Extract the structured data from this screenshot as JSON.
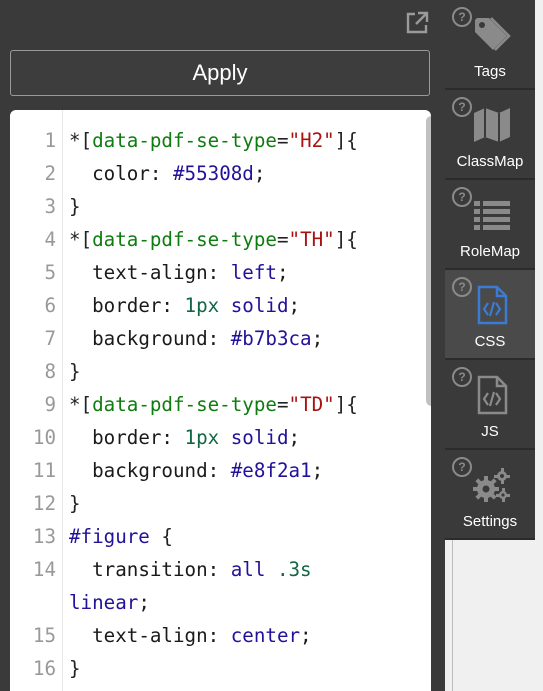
{
  "toolbar": {
    "apply_label": "Apply"
  },
  "editor": {
    "lines": [
      {
        "num": "1",
        "parts": [
          {
            "c": "t-sel",
            "t": "*["
          },
          {
            "c": "t-attr",
            "t": "data-pdf-se-type"
          },
          {
            "c": "t-sel",
            "t": "="
          },
          {
            "c": "t-str",
            "t": "\"H2\""
          },
          {
            "c": "t-sel",
            "t": "]{"
          }
        ]
      },
      {
        "num": "2",
        "parts": [
          {
            "c": "t-prop",
            "t": "  color: "
          },
          {
            "c": "t-val",
            "t": "#55308d"
          },
          {
            "c": "t-prop",
            "t": ";"
          }
        ]
      },
      {
        "num": "3",
        "parts": [
          {
            "c": "t-sel",
            "t": "}"
          }
        ]
      },
      {
        "num": "4",
        "parts": [
          {
            "c": "t-sel",
            "t": "*["
          },
          {
            "c": "t-attr",
            "t": "data-pdf-se-type"
          },
          {
            "c": "t-sel",
            "t": "="
          },
          {
            "c": "t-str",
            "t": "\"TH\""
          },
          {
            "c": "t-sel",
            "t": "]{"
          }
        ]
      },
      {
        "num": "5",
        "parts": [
          {
            "c": "t-prop",
            "t": "  text-align: "
          },
          {
            "c": "t-val",
            "t": "left"
          },
          {
            "c": "t-prop",
            "t": ";"
          }
        ]
      },
      {
        "num": "6",
        "parts": [
          {
            "c": "t-prop",
            "t": "  border: "
          },
          {
            "c": "t-num",
            "t": "1px"
          },
          {
            "c": "t-prop",
            "t": " "
          },
          {
            "c": "t-val",
            "t": "solid"
          },
          {
            "c": "t-prop",
            "t": ";"
          }
        ]
      },
      {
        "num": "7",
        "parts": [
          {
            "c": "t-prop",
            "t": "  background: "
          },
          {
            "c": "t-val",
            "t": "#b7b3ca"
          },
          {
            "c": "t-prop",
            "t": ";"
          }
        ]
      },
      {
        "num": "8",
        "parts": [
          {
            "c": "t-sel",
            "t": "}"
          }
        ]
      },
      {
        "num": "9",
        "parts": [
          {
            "c": "t-sel",
            "t": "*["
          },
          {
            "c": "t-attr",
            "t": "data-pdf-se-type"
          },
          {
            "c": "t-sel",
            "t": "="
          },
          {
            "c": "t-str",
            "t": "\"TD\""
          },
          {
            "c": "t-sel",
            "t": "]{"
          }
        ]
      },
      {
        "num": "10",
        "parts": [
          {
            "c": "t-prop",
            "t": "  border: "
          },
          {
            "c": "t-num",
            "t": "1px"
          },
          {
            "c": "t-prop",
            "t": " "
          },
          {
            "c": "t-val",
            "t": "solid"
          },
          {
            "c": "t-prop",
            "t": ";"
          }
        ]
      },
      {
        "num": "11",
        "parts": [
          {
            "c": "t-prop",
            "t": "  background: "
          },
          {
            "c": "t-val",
            "t": "#e8f2a1"
          },
          {
            "c": "t-prop",
            "t": ";"
          }
        ]
      },
      {
        "num": "12",
        "parts": [
          {
            "c": "t-sel",
            "t": "}"
          }
        ]
      },
      {
        "num": "13",
        "parts": [
          {
            "c": "t-id",
            "t": "#figure"
          },
          {
            "c": "t-sel",
            "t": " {"
          }
        ]
      },
      {
        "num": "14",
        "wrap": true,
        "parts": [
          {
            "c": "t-prop",
            "t": "  transition: "
          },
          {
            "c": "t-val",
            "t": "all"
          },
          {
            "c": "t-prop",
            "t": " "
          },
          {
            "c": "t-num",
            "t": ".3s"
          },
          {
            "c": "t-prop",
            "t": "\n"
          },
          {
            "c": "t-val",
            "t": "linear"
          },
          {
            "c": "t-prop",
            "t": ";"
          }
        ]
      },
      {
        "num": "15",
        "parts": [
          {
            "c": "t-prop",
            "t": "  text-align: "
          },
          {
            "c": "t-val",
            "t": "center"
          },
          {
            "c": "t-prop",
            "t": ";"
          }
        ]
      },
      {
        "num": "16",
        "parts": [
          {
            "c": "t-sel",
            "t": "}"
          }
        ]
      }
    ]
  },
  "sidebar": {
    "tabs": [
      {
        "label": "Tags",
        "icon": "tag-icon"
      },
      {
        "label": "ClassMap",
        "icon": "map-icon"
      },
      {
        "label": "RoleMap",
        "icon": "list-icon"
      },
      {
        "label": "CSS",
        "icon": "css-file-icon",
        "active": true
      },
      {
        "label": "JS",
        "icon": "js-file-icon"
      },
      {
        "label": "Settings",
        "icon": "gears-icon"
      }
    ],
    "help_glyph": "?"
  },
  "colors": {
    "panel": "#3a3a3a",
    "accent": "#3a7bd5",
    "icon_gray": "#8a8a8a"
  }
}
